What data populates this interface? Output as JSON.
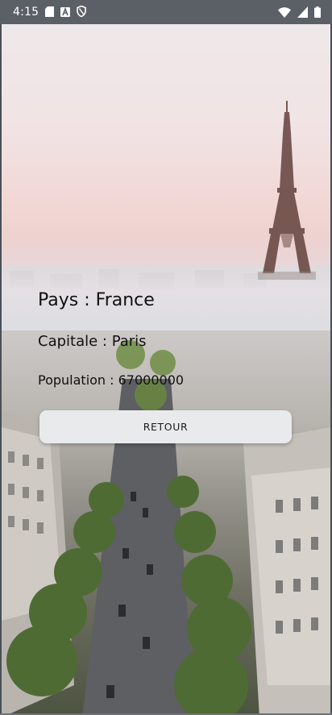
{
  "status_bar": {
    "time": "4:15",
    "left_icons": [
      "sd-card-icon",
      "a-badge-icon",
      "shield-icon"
    ],
    "right_icons": [
      "wifi-icon",
      "signal-icon",
      "battery-icon"
    ]
  },
  "country": {
    "pays": "Pays : France",
    "capitale": "Capitale : Paris",
    "population": "Population : 67000000"
  },
  "actions": {
    "retour_label": "RETOUR"
  },
  "colors": {
    "status_bar_bg": "#5b5f66",
    "button_bg": "#e8eaec",
    "text": "#111111"
  }
}
